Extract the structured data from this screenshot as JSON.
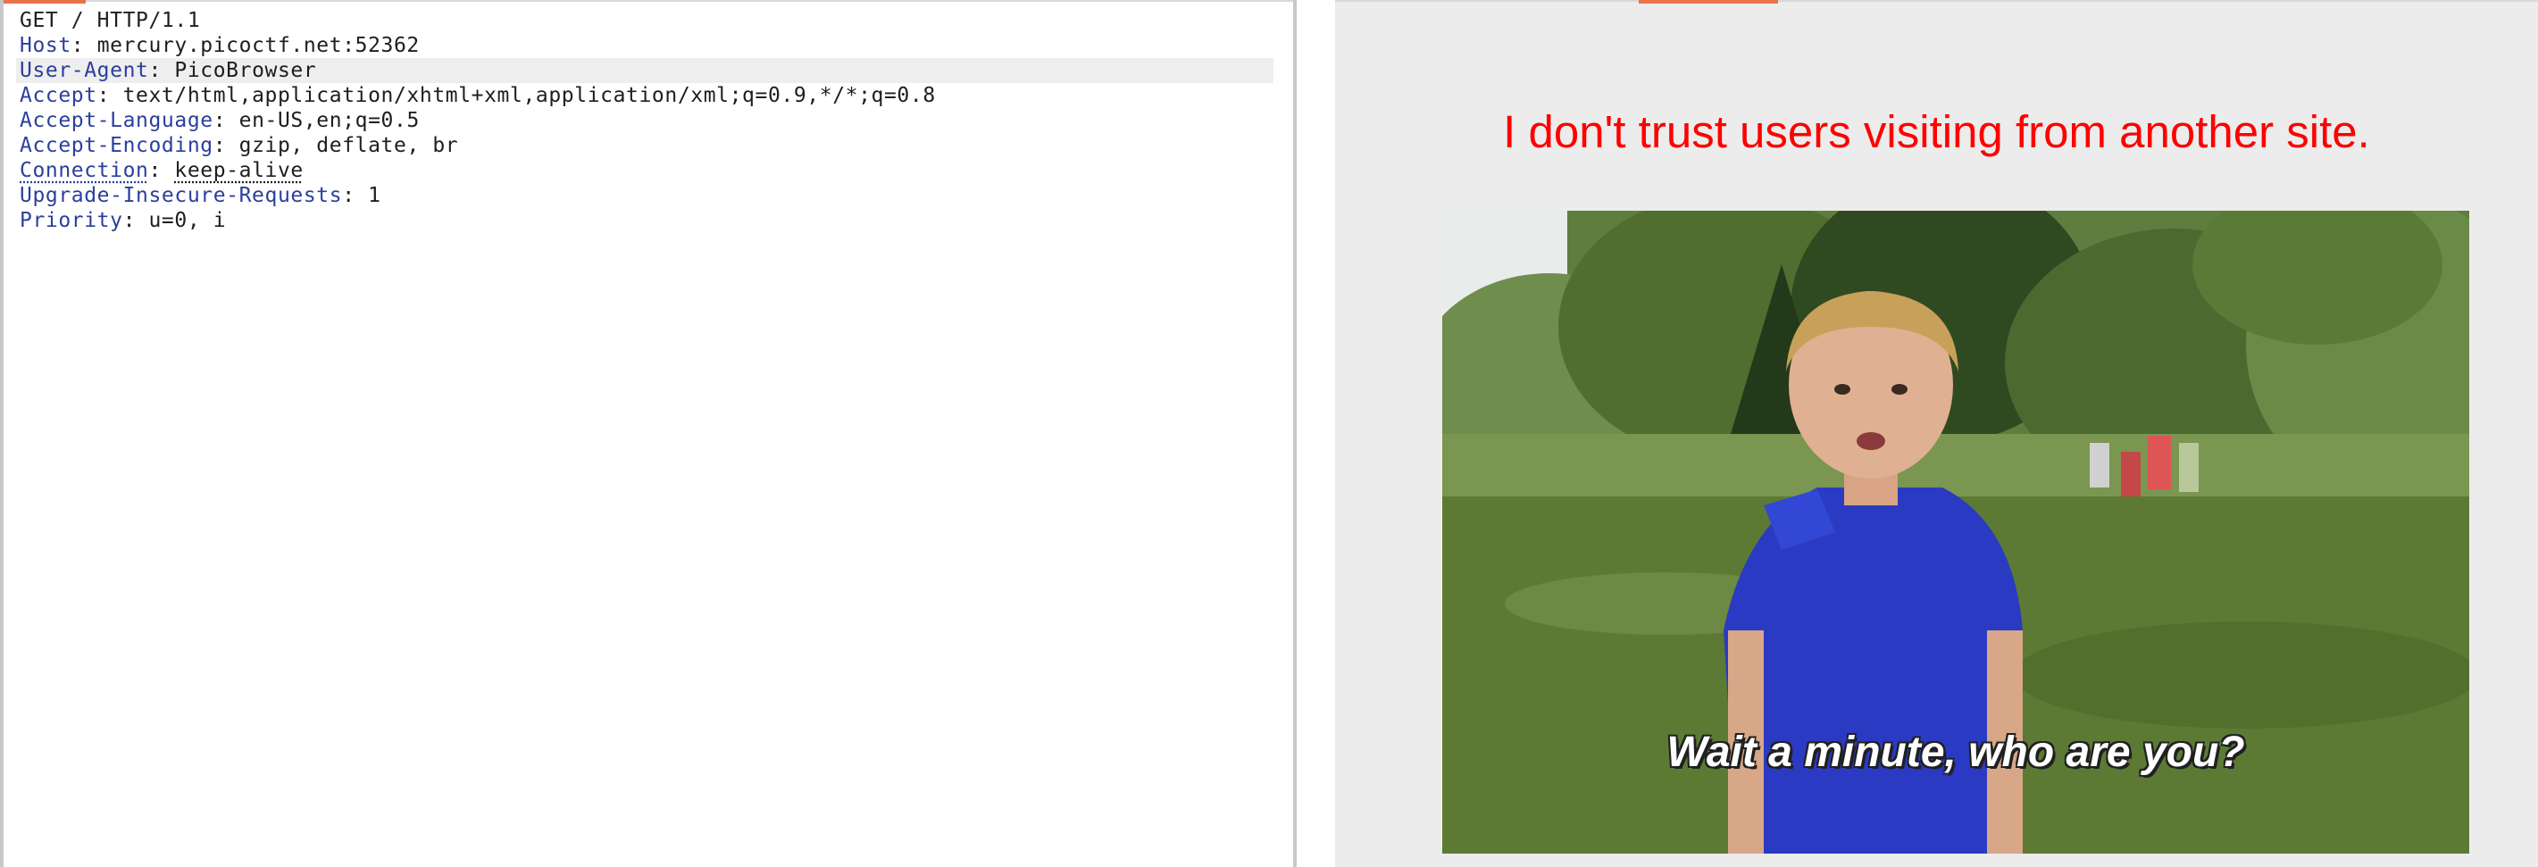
{
  "request": {
    "request_line": "GET / HTTP/1.1",
    "headers": [
      {
        "name": "Host",
        "value": "mercury.picoctf.net:52362"
      },
      {
        "name": "User-Agent",
        "value": "PicoBrowser"
      },
      {
        "name": "Accept",
        "value": "text/html,application/xhtml+xml,application/xml;q=0.9,*/*;q=0.8"
      },
      {
        "name": "Accept-Language",
        "value": "en-US,en;q=0.5"
      },
      {
        "name": "Accept-Encoding",
        "value": "gzip, deflate, br"
      },
      {
        "name": "Connection",
        "value": "keep-alive"
      },
      {
        "name": "Upgrade-Insecure-Requests",
        "value": "1"
      },
      {
        "name": "Priority",
        "value": "u=0, i"
      }
    ],
    "separator": ": "
  },
  "response": {
    "headline": "I don't trust users visiting from another site.",
    "meme_caption": "Wait a minute, who are you?"
  },
  "colors": {
    "header_name": "#2b3f9c",
    "headline": "#ff0000",
    "accent": "#e8734a"
  }
}
